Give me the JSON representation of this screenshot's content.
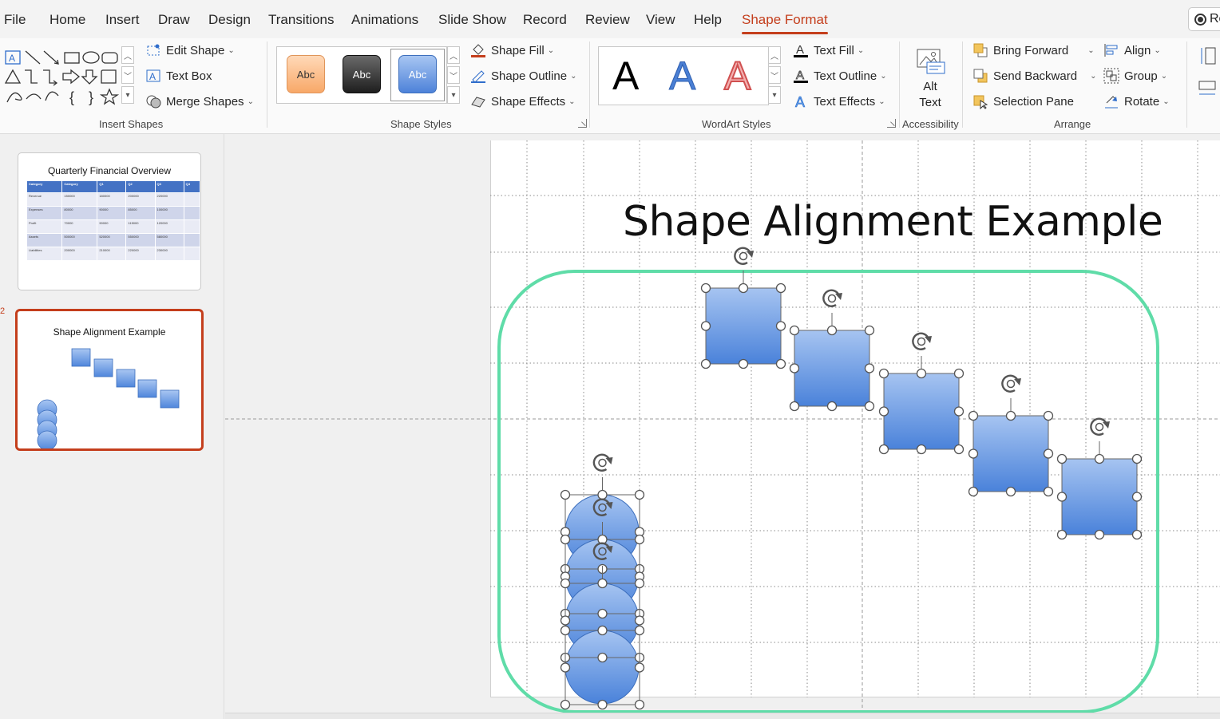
{
  "menu": {
    "tabs": [
      "File",
      "Home",
      "Insert",
      "Draw",
      "Design",
      "Transitions",
      "Animations",
      "Slide Show",
      "Record",
      "Review",
      "View",
      "Help",
      "Shape Format"
    ],
    "active_tab": "Shape Format",
    "record_label": "Re"
  },
  "ribbon": {
    "insert_shapes": {
      "label": "Insert Shapes",
      "edit_shape": "Edit Shape",
      "text_box": "Text Box",
      "merge_shapes": "Merge Shapes"
    },
    "shape_styles": {
      "label": "Shape Styles",
      "chips": [
        "Abc",
        "Abc",
        "Abc"
      ],
      "chip_colors": [
        "#f8b27a",
        "#3a3a3a",
        "#5b8fe0"
      ],
      "shape_fill": "Shape Fill",
      "shape_outline": "Shape Outline",
      "shape_effects": "Shape Effects"
    },
    "wordart": {
      "label": "WordArt Styles",
      "samples": [
        "A",
        "A",
        "A"
      ],
      "sample_colors": [
        "#000000",
        "#4a7fd4",
        "#e07070"
      ],
      "text_fill": "Text Fill",
      "text_outline": "Text Outline",
      "text_effects": "Text Effects"
    },
    "accessibility": {
      "label": "Accessibility",
      "alt_text_line1": "Alt",
      "alt_text_line2": "Text"
    },
    "arrange": {
      "label": "Arrange",
      "bring_forward": "Bring Forward",
      "send_backward": "Send Backward",
      "selection_pane": "Selection Pane",
      "align": "Align",
      "group": "Group",
      "rotate": "Rotate"
    }
  },
  "slides_panel": {
    "slide1": {
      "title": "Quarterly Financial Overview",
      "table_header": [
        "Category",
        "Category",
        "Q1",
        "Q2",
        "Q3",
        "Q4"
      ],
      "table_rows": [
        [
          "Revenue",
          "150000",
          "180000",
          "200000",
          "220000",
          ""
        ],
        [
          "Expenses",
          "80000",
          "90000",
          "85000",
          "100000",
          ""
        ],
        [
          "Profit",
          "70000",
          "90000",
          "115000",
          "120000",
          ""
        ],
        [
          "Assets",
          "500000",
          "520000",
          "550000",
          "580000",
          ""
        ],
        [
          "Liabilities",
          "200000",
          "210000",
          "220000",
          "230000",
          ""
        ]
      ]
    },
    "slide2": {
      "title": "Shape Alignment Example",
      "number": "2"
    }
  },
  "slide": {
    "title": "Shape Alignment Example",
    "squares_count": 5,
    "circles_count": 4,
    "accent_shape_color": "#5b8fe0",
    "outline_shape_color": "#5fdca8"
  }
}
